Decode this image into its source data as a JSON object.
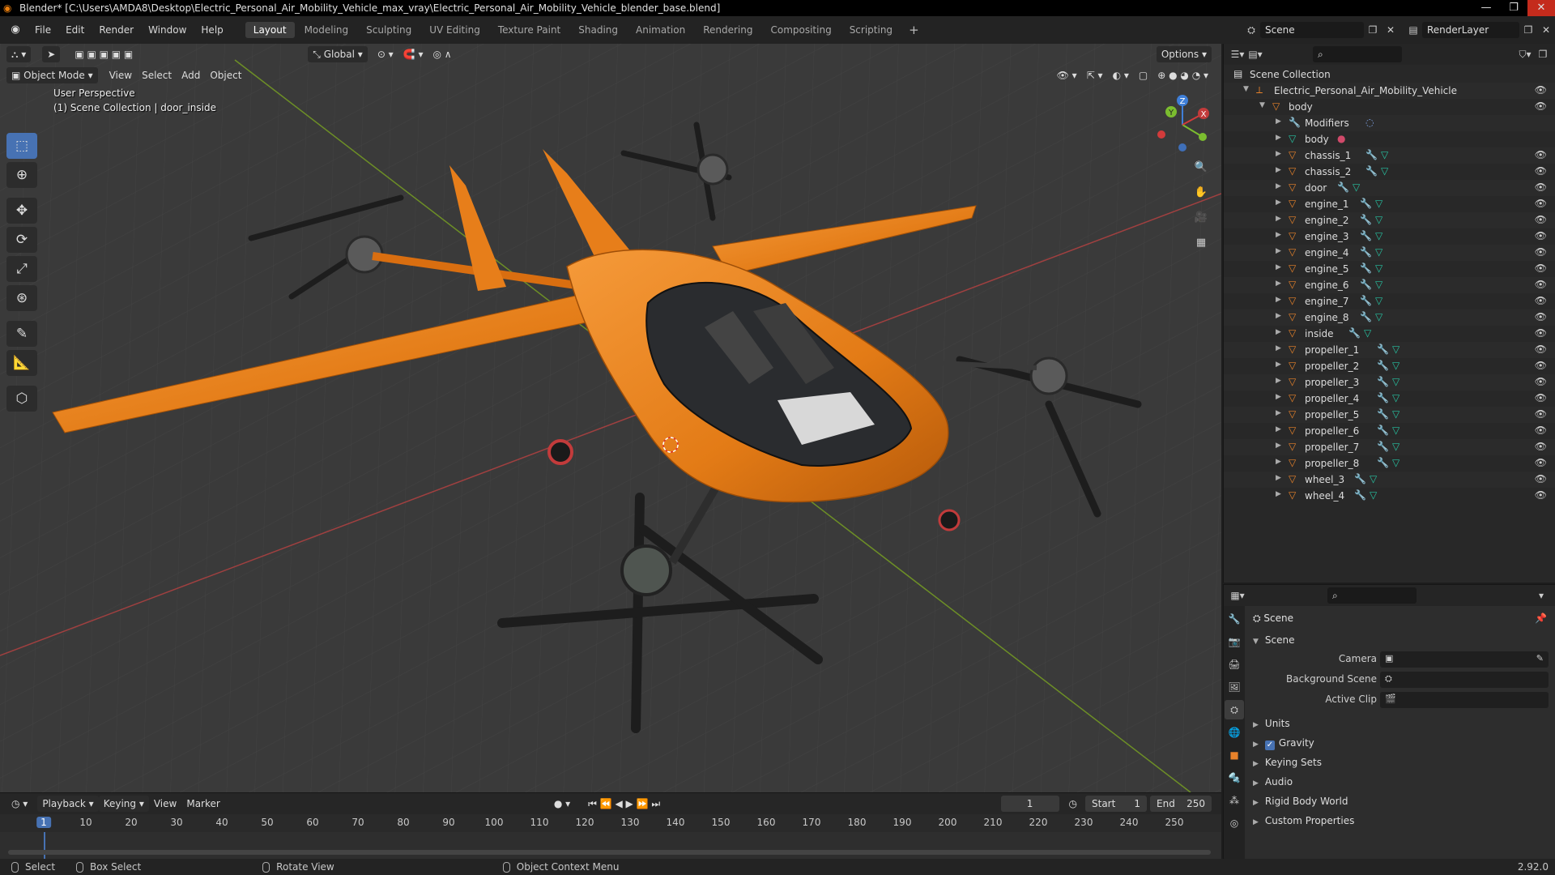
{
  "window": {
    "title": "Blender* [C:\\Users\\AMDA8\\Desktop\\Electric_Personal_Air_Mobility_Vehicle_max_vray\\Electric_Personal_Air_Mobility_Vehicle_blender_base.blend]"
  },
  "menu": [
    "File",
    "Edit",
    "Render",
    "Window",
    "Help"
  ],
  "workspaces": [
    {
      "label": "Layout",
      "active": true
    },
    {
      "label": "Modeling",
      "active": false
    },
    {
      "label": "Sculpting",
      "active": false
    },
    {
      "label": "UV Editing",
      "active": false
    },
    {
      "label": "Texture Paint",
      "active": false
    },
    {
      "label": "Shading",
      "active": false
    },
    {
      "label": "Animation",
      "active": false
    },
    {
      "label": "Rendering",
      "active": false
    },
    {
      "label": "Compositing",
      "active": false
    },
    {
      "label": "Scripting",
      "active": false
    }
  ],
  "scene_selector": {
    "scene": "Scene",
    "view_layer": "RenderLayer"
  },
  "viewport": {
    "mode": "Object Mode",
    "menus": [
      "View",
      "Select",
      "Add",
      "Object"
    ],
    "transform_orientation": "Global",
    "options_label": "Options",
    "perspective_label": "User Perspective",
    "collection_label": "(1) Scene Collection | door_inside"
  },
  "gizmo": {
    "x": "X",
    "y": "Y",
    "z": "Z"
  },
  "timeline": {
    "menus": [
      "Playback",
      "Keying",
      "View",
      "Marker"
    ],
    "current_frame": "1",
    "start_label": "Start",
    "start_value": "1",
    "end_label": "End",
    "end_value": "250",
    "ticks": [
      "1",
      "10",
      "20",
      "30",
      "40",
      "50",
      "60",
      "70",
      "80",
      "90",
      "100",
      "110",
      "120",
      "130",
      "140",
      "150",
      "160",
      "170",
      "180",
      "190",
      "200",
      "210",
      "220",
      "230",
      "240",
      "250"
    ]
  },
  "statusbar": {
    "select": "Select",
    "box_select": "Box Select",
    "rotate_view": "Rotate View",
    "context_menu": "Object Context Menu",
    "version": "2.92.0"
  },
  "outliner": {
    "root": "Scene Collection",
    "collection": "Electric_Personal_Air_Mobility_Vehicle",
    "parent": "body",
    "items": [
      {
        "label": "Modifiers",
        "kind": "modifier"
      },
      {
        "label": "body",
        "kind": "mesh"
      },
      {
        "label": "chassis_1",
        "kind": "object"
      },
      {
        "label": "chassis_2",
        "kind": "object"
      },
      {
        "label": "door",
        "kind": "object"
      },
      {
        "label": "engine_1",
        "kind": "object"
      },
      {
        "label": "engine_2",
        "kind": "object"
      },
      {
        "label": "engine_3",
        "kind": "object"
      },
      {
        "label": "engine_4",
        "kind": "object"
      },
      {
        "label": "engine_5",
        "kind": "object"
      },
      {
        "label": "engine_6",
        "kind": "object"
      },
      {
        "label": "engine_7",
        "kind": "object"
      },
      {
        "label": "engine_8",
        "kind": "object"
      },
      {
        "label": "inside",
        "kind": "object"
      },
      {
        "label": "propeller_1",
        "kind": "object"
      },
      {
        "label": "propeller_2",
        "kind": "object"
      },
      {
        "label": "propeller_3",
        "kind": "object"
      },
      {
        "label": "propeller_4",
        "kind": "object"
      },
      {
        "label": "propeller_5",
        "kind": "object"
      },
      {
        "label": "propeller_6",
        "kind": "object"
      },
      {
        "label": "propeller_7",
        "kind": "object"
      },
      {
        "label": "propeller_8",
        "kind": "object"
      },
      {
        "label": "wheel_3",
        "kind": "object"
      },
      {
        "label": "wheel_4",
        "kind": "object"
      }
    ]
  },
  "properties": {
    "context": "Scene",
    "panel": "Scene",
    "fields": [
      {
        "label": "Camera"
      },
      {
        "label": "Background Scene"
      },
      {
        "label": "Active Clip"
      }
    ],
    "subpanels": [
      {
        "label": "Units",
        "checkbox": false
      },
      {
        "label": "Gravity",
        "checkbox": true
      },
      {
        "label": "Keying Sets",
        "checkbox": false
      },
      {
        "label": "Audio",
        "checkbox": false
      },
      {
        "label": "Rigid Body World",
        "checkbox": false
      },
      {
        "label": "Custom Properties",
        "checkbox": false
      }
    ]
  },
  "colors": {
    "accent": "#4772b3",
    "vehicle_orange": "#e8821e",
    "axis_x": "#c84545",
    "axis_y": "#7ea82a",
    "object_icon": "#e8822a",
    "mesh_icon": "#27c3a2"
  }
}
